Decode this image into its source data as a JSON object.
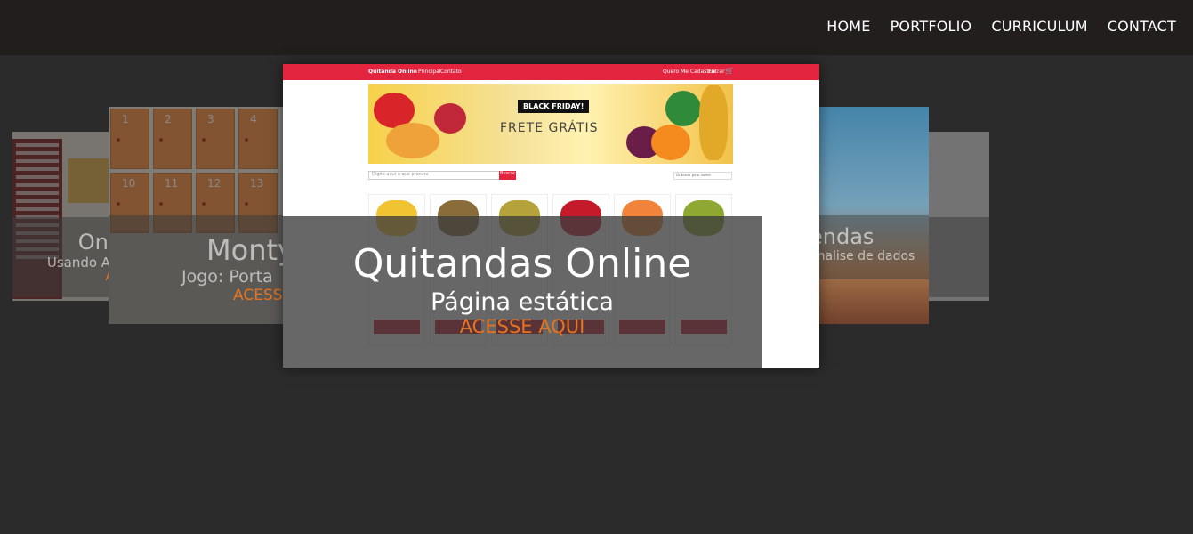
{
  "nav": {
    "items": [
      "HOME",
      "PORTFOLIO",
      "CURRICULUM",
      "CONTACT"
    ]
  },
  "carousel": {
    "store": {
      "title": "Online Store",
      "subtitle": "Usando API do Mercado Livre",
      "link": "ACESSE AQUI"
    },
    "monty": {
      "title": "Monty",
      "subtitle": "Jogo: Porta",
      "link": "ACESSE"
    },
    "lendas": {
      "title": "endas",
      "subtitle": "analise de dados"
    },
    "quitanda": {
      "title": "Quitandas Online",
      "subtitle": "Página estática",
      "link": "ACESSE AQUI",
      "preview": {
        "brand": "Quitanda Online",
        "nav": [
          "Principal",
          "Contato"
        ],
        "right_links": [
          "Quero Me Cadastrar",
          "Entrar"
        ],
        "banner_badge": "BLACK FRIDAY!",
        "banner_text": "FRETE GRÁTIS",
        "search_placeholder": "Digite aqui o que procura",
        "search_button": "Buscar",
        "order_select": "Ordenar pelo nome"
      }
    },
    "memory_tiles": [
      "1",
      "2",
      "3",
      "4",
      "10",
      "11",
      "12",
      "13"
    ]
  },
  "colors": {
    "navbar": "#221e1e",
    "background": "#2b2b2b",
    "accent": "#e8731e",
    "quitanda_red": "#e2243e"
  }
}
